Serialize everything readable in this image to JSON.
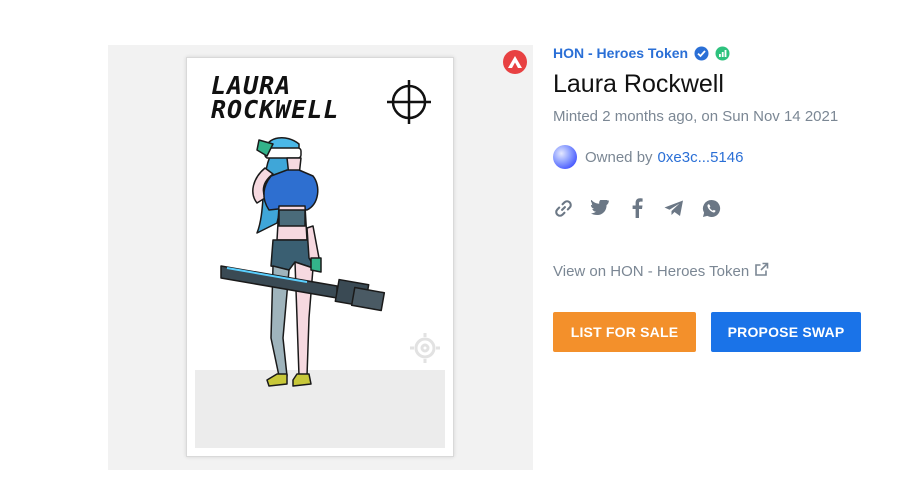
{
  "card": {
    "title": "LAURA\nROCKWELL"
  },
  "chain": {
    "icon": "avalanche-icon",
    "color": "#e84142"
  },
  "collection": {
    "name": "HON - Heroes Token",
    "verified_icon": "verified-badge-icon",
    "stats_icon": "stats-icon"
  },
  "nft": {
    "title": "Laura Rockwell",
    "minted": "Minted 2 months ago, on Sun Nov 14 2021"
  },
  "owner": {
    "label": "Owned by",
    "address": "0xe3c...5146"
  },
  "share": [
    {
      "icon": "link-icon"
    },
    {
      "icon": "twitter-icon"
    },
    {
      "icon": "facebook-icon"
    },
    {
      "icon": "telegram-icon"
    },
    {
      "icon": "whatsapp-icon"
    }
  ],
  "view_link": {
    "label": "View on HON - Heroes Token",
    "icon": "external-link-icon"
  },
  "actions": {
    "list_for_sale": "LIST FOR SALE",
    "propose_swap": "PROPOSE SWAP"
  },
  "colors": {
    "accent_blue": "#1a73e8",
    "accent_orange": "#f3902b",
    "link_blue": "#2a6fd6",
    "muted_text": "#7b8794"
  }
}
